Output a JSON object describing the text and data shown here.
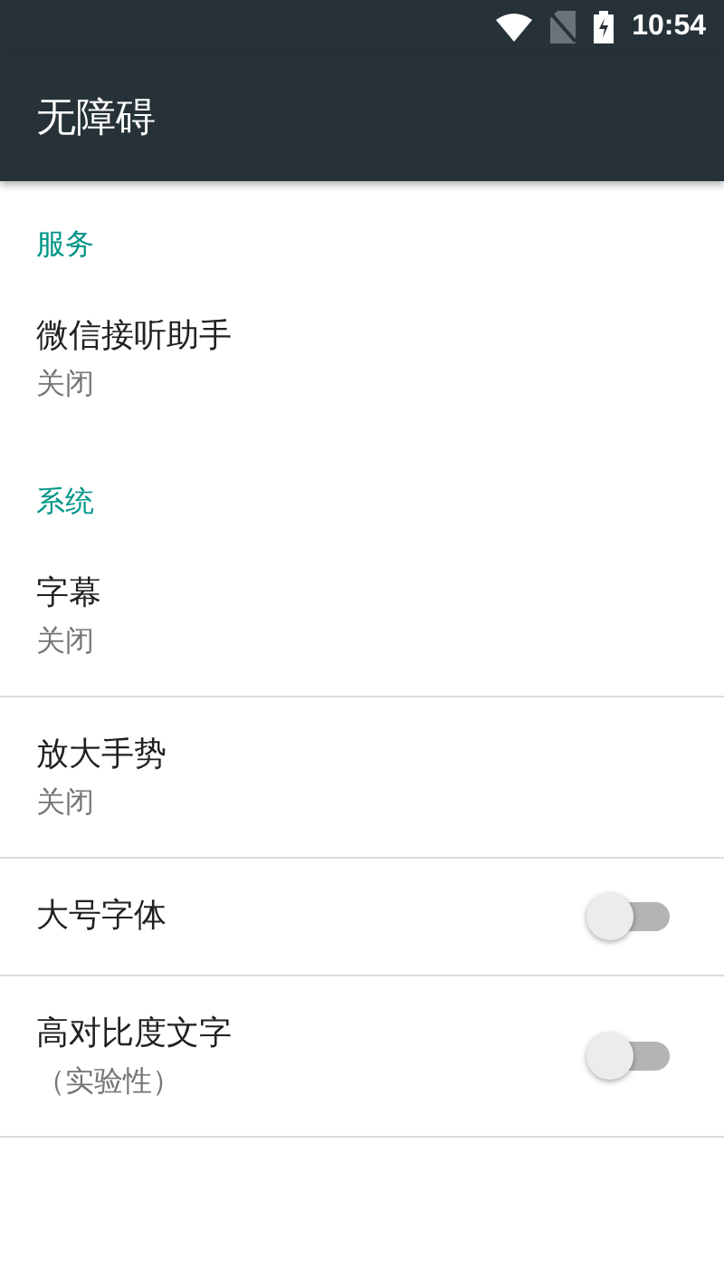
{
  "status_bar": {
    "time": "10:54"
  },
  "app_bar": {
    "title": "无障碍"
  },
  "sections": [
    {
      "title": "服务",
      "dividers": false,
      "items": [
        {
          "kind": "text",
          "title": "微信接听助手",
          "summary": "关闭"
        }
      ]
    },
    {
      "title": "系统",
      "dividers": true,
      "items": [
        {
          "kind": "text",
          "title": "字幕",
          "summary": "关闭"
        },
        {
          "kind": "text",
          "title": "放大手势",
          "summary": "关闭"
        },
        {
          "kind": "switch",
          "title": "大号字体",
          "on": false
        },
        {
          "kind": "switch",
          "title": "高对比度文字",
          "summary": "（实验性）",
          "on": false
        }
      ]
    }
  ]
}
